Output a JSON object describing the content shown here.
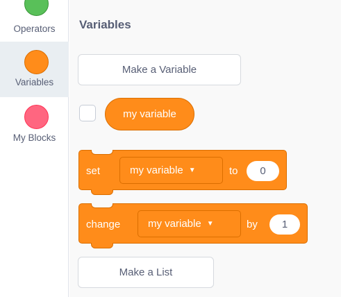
{
  "sidebar": {
    "categories": [
      {
        "label": "Operators",
        "color": "#59c059",
        "selected": false
      },
      {
        "label": "Variables",
        "color": "#ff8c1a",
        "selected": true
      },
      {
        "label": "My Blocks",
        "color": "#ff6680",
        "selected": false
      }
    ]
  },
  "palette": {
    "title": "Variables",
    "make_variable_label": "Make a Variable",
    "make_list_label": "Make a List",
    "variable_reporter": {
      "name": "my variable",
      "checked": false
    },
    "set_block": {
      "keyword": "set",
      "variable": "my variable",
      "connector": "to",
      "value": "0"
    },
    "change_block": {
      "keyword": "change",
      "variable": "my variable",
      "connector": "by",
      "value": "1"
    }
  },
  "icons": {
    "dropdown_caret": "caret-down-icon"
  },
  "colors": {
    "variables_block": "#ff8c1a",
    "block_border": "#db6e00",
    "text_muted": "#575e75"
  }
}
